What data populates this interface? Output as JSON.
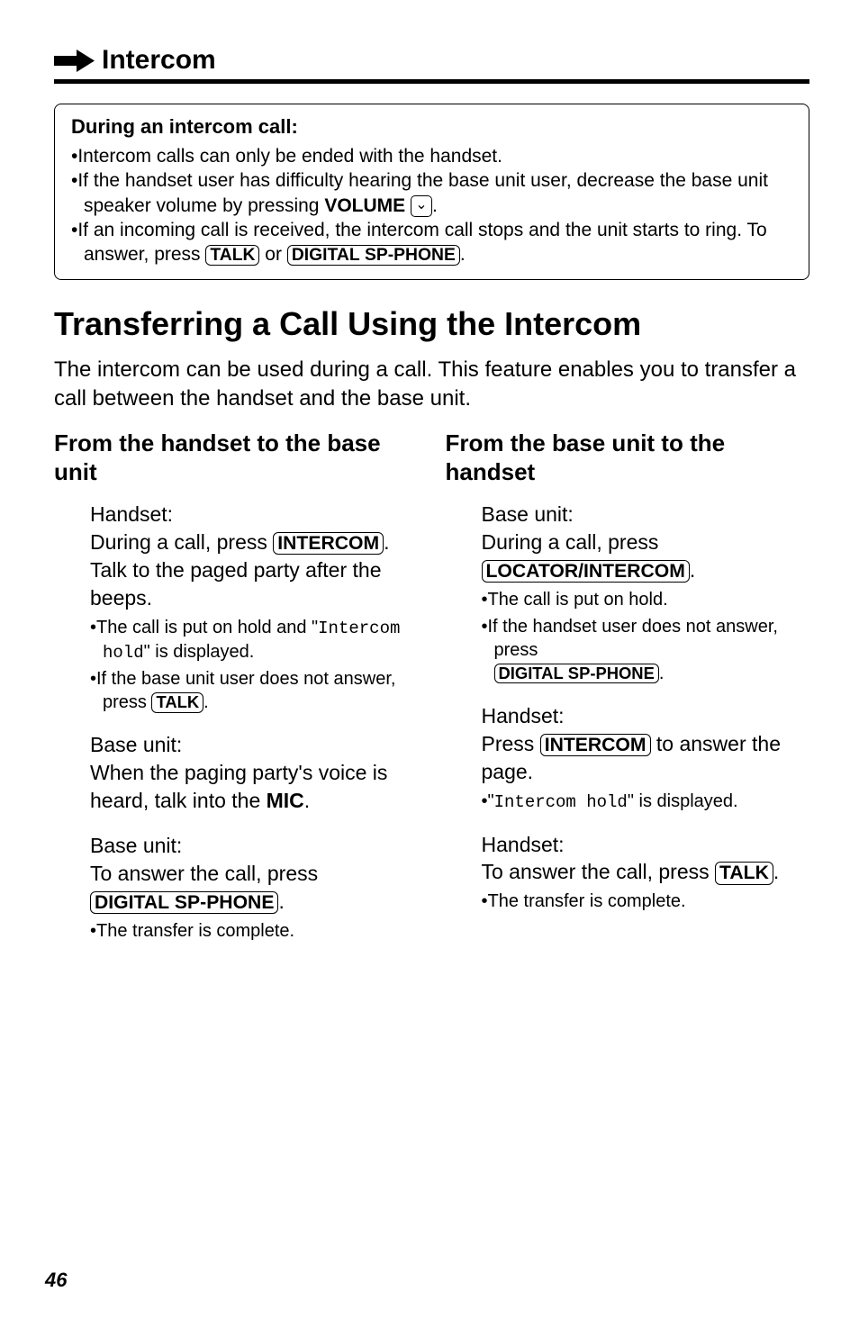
{
  "header": {
    "title": "Intercom"
  },
  "box": {
    "title": "During an intercom call:",
    "l1": "•Intercom calls can only be ended with the handset.",
    "l2a": "•If the handset user has difficulty hearing the base unit user, decrease the base unit speaker volume by pressing ",
    "l2_vol": "VOLUME",
    "l2_arrow": "⌄",
    "l2b": ".",
    "l3a": "•If an incoming call is received, the intercom call stops and the unit starts to ring. To answer, press ",
    "l3_btn1": "TALK",
    "l3_mid": " or ",
    "l3_btn2": "DIGITAL SP-PHONE",
    "l3b": "."
  },
  "main_title": "Transferring a Call Using the Intercom",
  "intro": "The intercom can be used during a call. This feature enables you to transfer a call between the handset and the base unit.",
  "left": {
    "title": "From the handset to the base unit",
    "s1_head": "Handset:",
    "s1_a": "During a call, press ",
    "s1_btn": "INTERCOM",
    "s1_b": ". Talk to the paged party after the beeps.",
    "s1_sub1a": "•The call is put on hold and \"",
    "s1_sub1_mono": "Intercom hold",
    "s1_sub1b": "\" is displayed.",
    "s1_sub2a": "•If the base unit user does not answer, press ",
    "s1_sub2_btn": "TALK",
    "s1_sub2b": ".",
    "s2_head": "Base unit:",
    "s2_a": "When the paging party's voice is heard, talk into the ",
    "s2_mic": "MIC",
    "s2_b": ".",
    "s3_head": "Base unit:",
    "s3_a": "To answer the call, press ",
    "s3_btn": "DIGITAL SP-PHONE",
    "s3_b": ".",
    "s3_sub": "•The transfer is complete."
  },
  "right": {
    "title": "From the base unit to the handset",
    "s1_head": "Base unit:",
    "s1_a": "During a call, press ",
    "s1_btn": "LOCATOR/INTERCOM",
    "s1_b": ".",
    "s1_sub1": "•The call is put on hold.",
    "s1_sub2a": "•If the handset user does not answer, press ",
    "s1_sub2_btn": "DIGITAL SP-PHONE",
    "s1_sub2b": ".",
    "s2_head": "Handset:",
    "s2_a": "Press ",
    "s2_btn": "INTERCOM",
    "s2_b": " to answer the page.",
    "s2_sub_a": "•\"",
    "s2_sub_mono": "Intercom hold",
    "s2_sub_b": "\" is displayed.",
    "s3_head": "Handset:",
    "s3_a": "To answer the call, press ",
    "s3_btn": "TALK",
    "s3_b": ".",
    "s3_sub": "•The transfer is complete."
  },
  "page_number": "46"
}
